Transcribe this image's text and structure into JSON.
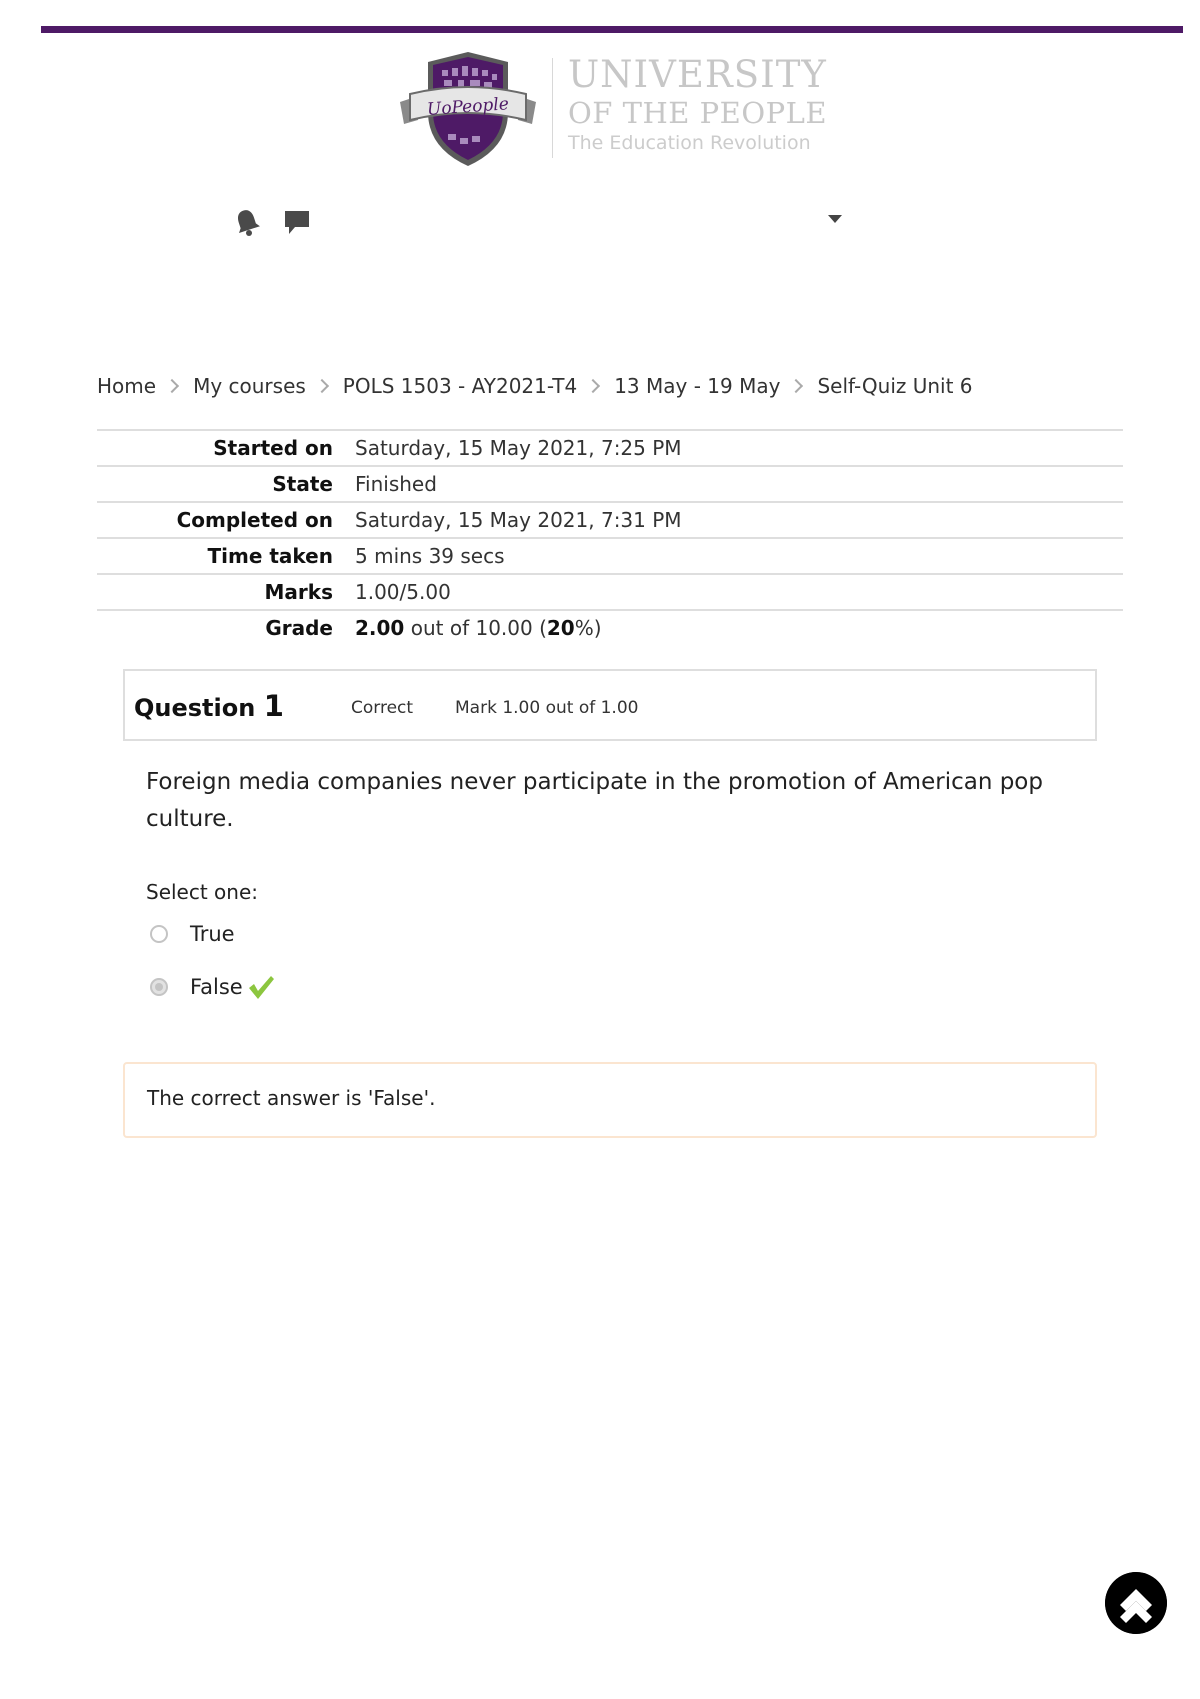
{
  "colors": {
    "brand_purple": "#4e1a66",
    "check_green": "#8cc63f",
    "feedback_border": "#fbe5d0",
    "logo_text": "#c7c7c7"
  },
  "logo": {
    "badge_text": "UoPeople",
    "line1": "UNIVERSITY",
    "line2": "OF THE PEOPLE",
    "line3": "The Education Revolution"
  },
  "nav_icons": {
    "notifications": "bell-icon",
    "messages": "chat-icon",
    "user_menu": "caret-down-icon"
  },
  "breadcrumb": [
    "Home",
    "My courses",
    "POLS 1503 - AY2021-T4",
    "13 May - 19 May",
    "Self-Quiz Unit 6"
  ],
  "summary": {
    "started_on": {
      "label": "Started on",
      "value": "Saturday, 15 May 2021, 7:25 PM"
    },
    "state": {
      "label": "State",
      "value": "Finished"
    },
    "completed_on": {
      "label": "Completed on",
      "value": "Saturday, 15 May 2021, 7:31 PM"
    },
    "time_taken": {
      "label": "Time taken",
      "value": "5 mins 39 secs"
    },
    "marks": {
      "label": "Marks",
      "value": "1.00/5.00"
    },
    "grade": {
      "label": "Grade",
      "value_bold": "2.00",
      "value_mid": " out of 10.00 (",
      "percent_bold": "20",
      "value_end": "%)"
    }
  },
  "question": {
    "title": "Question",
    "number": "1",
    "state": "Correct",
    "mark": "Mark 1.00 out of 1.00",
    "text": " Foreign media companies never participate in the promotion of American pop culture.",
    "prompt": "Select one:",
    "options": [
      {
        "label": "True",
        "selected": false
      },
      {
        "label": "False",
        "selected": true
      }
    ],
    "feedback": "The correct answer is 'False'."
  }
}
